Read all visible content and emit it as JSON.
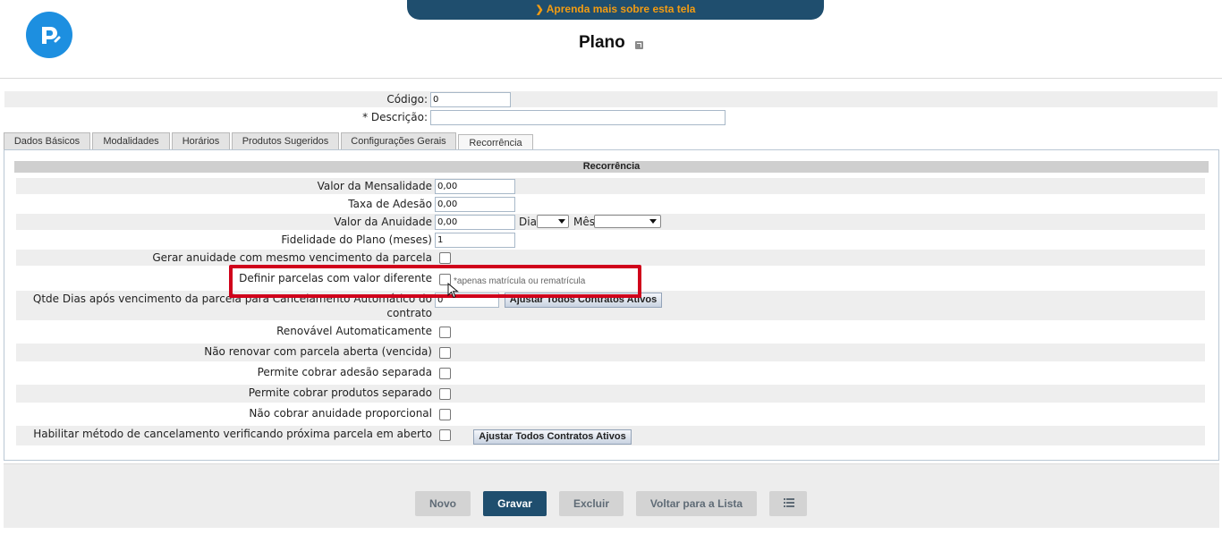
{
  "header": {
    "learn_more": "Aprenda mais sobre esta tela",
    "title": "Plano"
  },
  "fields": {
    "codigo_label": "Código:",
    "codigo_value": "0",
    "descricao_label": "* Descrição:",
    "descricao_value": ""
  },
  "tabs": [
    {
      "label": "Dados Básicos"
    },
    {
      "label": "Modalidades"
    },
    {
      "label": "Horários"
    },
    {
      "label": "Produtos Sugeridos"
    },
    {
      "label": "Configurações Gerais"
    },
    {
      "label": "Recorrência",
      "active": true
    }
  ],
  "recorrencia": {
    "section_title": "Recorrência",
    "valor_mensalidade_label": "Valor da Mensalidade",
    "valor_mensalidade": "0,00",
    "taxa_adesao_label": "Taxa de Adesão",
    "taxa_adesao": "0,00",
    "valor_anuidade_label": "Valor da Anuidade",
    "valor_anuidade": "0,00",
    "dia_label": "Dia",
    "mes_label": "Mês",
    "fidelidade_label": "Fidelidade do Plano (meses)",
    "fidelidade": "1",
    "gerar_anuidade_label": "Gerar anuidade com mesmo vencimento da parcela",
    "definir_parcelas_label": "Definir parcelas com valor diferente",
    "definir_parcelas_hint": "*apenas matrícula ou rematrícula",
    "qtde_dias_label_1": "Qtde Dias após vencimento da parcela para Cancelamento Automático do",
    "qtde_dias_label_2": "contrato",
    "qtde_dias_value": "0",
    "ajustar_contratos_1": "Ajustar Todos Contratos Ativos",
    "renovavel_label": "Renovável Automaticamente",
    "nao_renovar_label": "Não renovar com parcela aberta (vencida)",
    "cobrar_adesao_label": "Permite cobrar adesão separada",
    "cobrar_produtos_label": "Permite cobrar produtos separado",
    "nao_cobrar_anuidade_label": "Não cobrar anuidade proporcional",
    "habilitar_cancelamento_label": "Habilitar método de cancelamento verificando próxima parcela em aberto",
    "ajustar_contratos_2": "Ajustar Todos Contratos Ativos"
  },
  "footer": {
    "novo": "Novo",
    "gravar": "Gravar",
    "excluir": "Excluir",
    "voltar": "Voltar para a Lista"
  },
  "colors": {
    "primary": "#1f4e6e",
    "accent": "#f39c12",
    "highlight": "#d0021b",
    "logo": "#1d8fe0"
  },
  "icons": [
    "logo-icon",
    "chevron-down-icon",
    "external-link-icon",
    "list-icon",
    "mouse-cursor-icon"
  ]
}
